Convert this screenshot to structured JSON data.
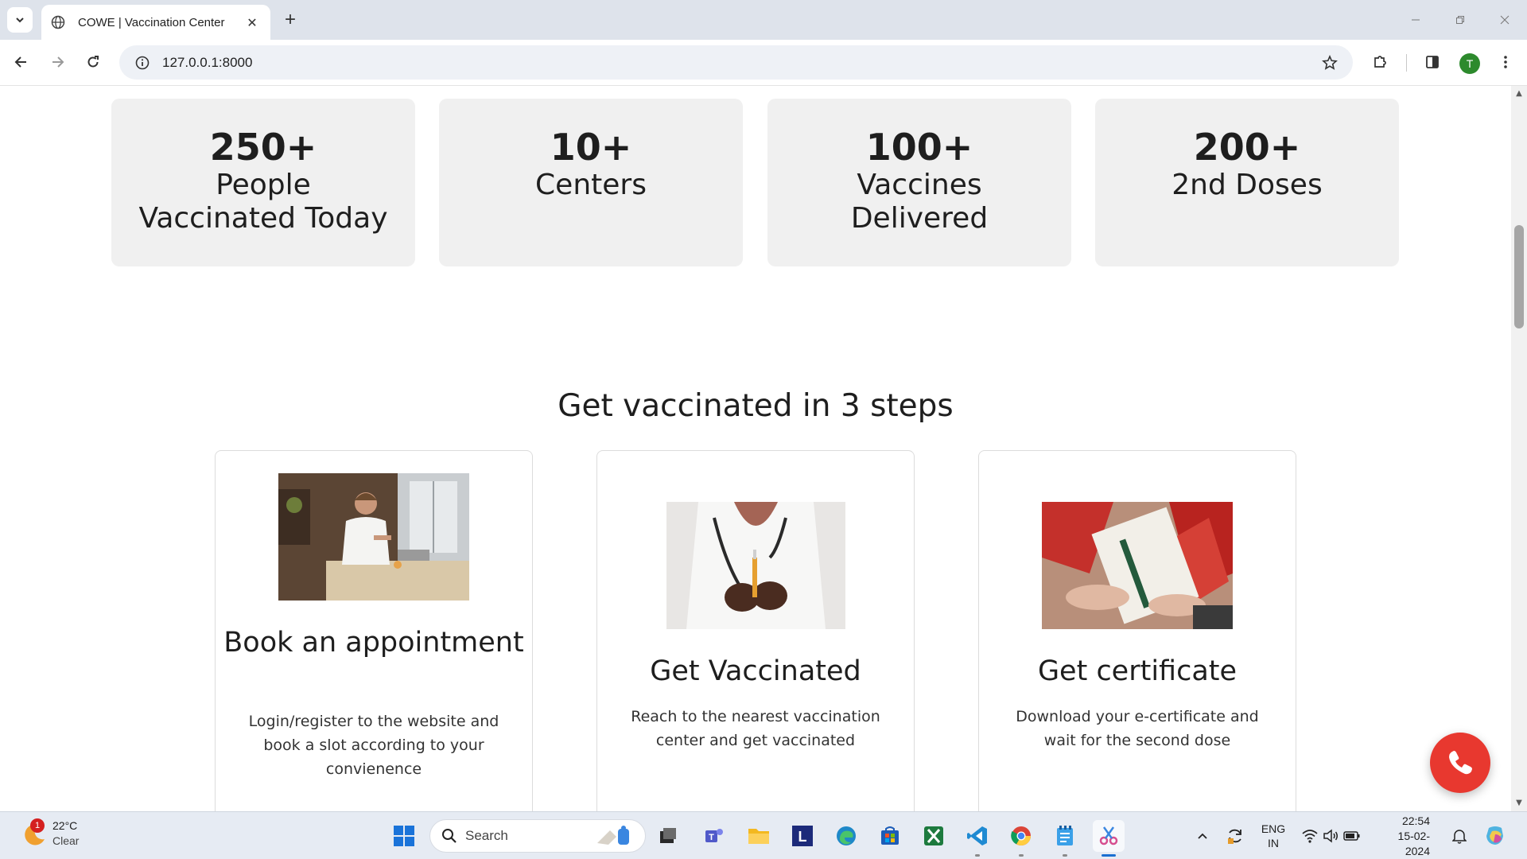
{
  "browser": {
    "tab_title": "COWE | Vaccination Center",
    "url": "127.0.0.1:8000",
    "profile_initial": "T"
  },
  "stats": [
    {
      "number": "250+",
      "label": "People Vaccinated Today"
    },
    {
      "number": "10+",
      "label": "Centers"
    },
    {
      "number": "100+",
      "label": "Vaccines Delivered"
    },
    {
      "number": "200+",
      "label": "2nd Doses"
    }
  ],
  "section_title": "Get vaccinated in 3 steps",
  "steps": [
    {
      "title": "Book an appointment",
      "desc": "Login/register to the website and book a slot according to your convienence"
    },
    {
      "title": "Get Vaccinated",
      "desc": "Reach to the nearest vaccination center and get vaccinated"
    },
    {
      "title": "Get certificate",
      "desc": "Download your e-certificate and wait for the second dose"
    }
  ],
  "taskbar": {
    "weather_temp": "22°C",
    "weather_cond": "Clear",
    "weather_badge": "1",
    "search_label": "Search",
    "lang_line1": "ENG",
    "lang_line2": "IN",
    "time": "22:54",
    "date": "15-02-2024"
  },
  "colors": {
    "call_button": "#e8382f",
    "stat_card_bg": "#f0f0f0",
    "tabstrip_bg": "#dee3eb"
  }
}
